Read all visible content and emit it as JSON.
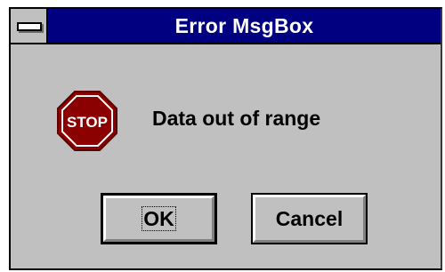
{
  "window": {
    "title": "Error MsgBox"
  },
  "icon": {
    "name": "stop-icon",
    "label": "STOP",
    "color": "#8b0000"
  },
  "message": "Data out of range",
  "buttons": {
    "ok_label": "OK",
    "cancel_label": "Cancel"
  },
  "colors": {
    "titlebar": "#000080",
    "face": "#c0c0c0"
  }
}
